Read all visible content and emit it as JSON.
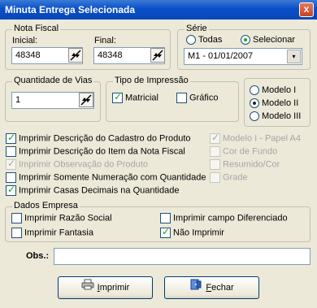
{
  "window": {
    "title": "Minuta Entrega Selecionada",
    "close_glyph": "x"
  },
  "nota_fiscal": {
    "legend": "Nota Fiscal",
    "inicial_label": "Inicial:",
    "inicial_value": "48348",
    "final_label": "Final:",
    "final_value": "48348"
  },
  "serie": {
    "legend": "Série",
    "todas_label": "Todas",
    "selecionar_label": "Selecionar",
    "selected_option": "selecionar",
    "select_value": "M1  - 01/01/2007"
  },
  "vias": {
    "legend": "Quantidade de Vias",
    "value": "1"
  },
  "tipo_impressao": {
    "legend": "Tipo de Impressão",
    "matricial_label": "Matricial",
    "matricial_checked": true,
    "grafico_label": "Gráfico",
    "grafico_checked": false
  },
  "modelos": {
    "modelo1_label": "Modelo I",
    "modelo2_label": "Modelo II",
    "modelo3_label": "Modelo III",
    "selected": "modelo2"
  },
  "options_left": [
    {
      "label": "Imprimir Descrição do Cadastro do Produto",
      "checked": true,
      "disabled": false
    },
    {
      "label": "Imprimir Descrição do Item da Nota Fiscal",
      "checked": false,
      "disabled": false
    },
    {
      "label": "Imprimir Observação do Produto",
      "checked": true,
      "disabled": true
    },
    {
      "label": "Imprimir Somente Numeração com Quantidade",
      "checked": false,
      "disabled": false
    },
    {
      "label": "Imprimir Casas Decimais na Quantidade",
      "checked": true,
      "disabled": false
    }
  ],
  "options_right": [
    {
      "label": "Modelo I - Papel A4",
      "checked": true,
      "disabled": true
    },
    {
      "label": "Cor de Fundo",
      "checked": false,
      "disabled": true
    },
    {
      "label": "Resumido/Cor",
      "checked": false,
      "disabled": true
    },
    {
      "label": "Grade",
      "checked": false,
      "disabled": true
    }
  ],
  "dados_empresa": {
    "legend": "Dados Empresa",
    "razao_social_label": "Imprimir Razão Social",
    "razao_social_checked": false,
    "fantasia_label": "Imprimir Fantasia",
    "fantasia_checked": false,
    "campo_diferenciado_label": "Imprimir campo Diferenciado",
    "campo_diferenciado_checked": false,
    "nao_imprimir_label": "Não Imprimir",
    "nao_imprimir_checked": true
  },
  "obs": {
    "label": "Obs.:",
    "value": ""
  },
  "buttons": {
    "imprimir_first": "I",
    "imprimir_rest": "mprimir",
    "fechar_first": "F",
    "fechar_rest": "echar"
  },
  "colors": {
    "title_bar": "#0a4fc9",
    "check_mark": "#21a121"
  },
  "icons": {
    "spin": "spin-arrows-icon",
    "printer": "printer-icon",
    "exit": "exit-door-icon"
  }
}
